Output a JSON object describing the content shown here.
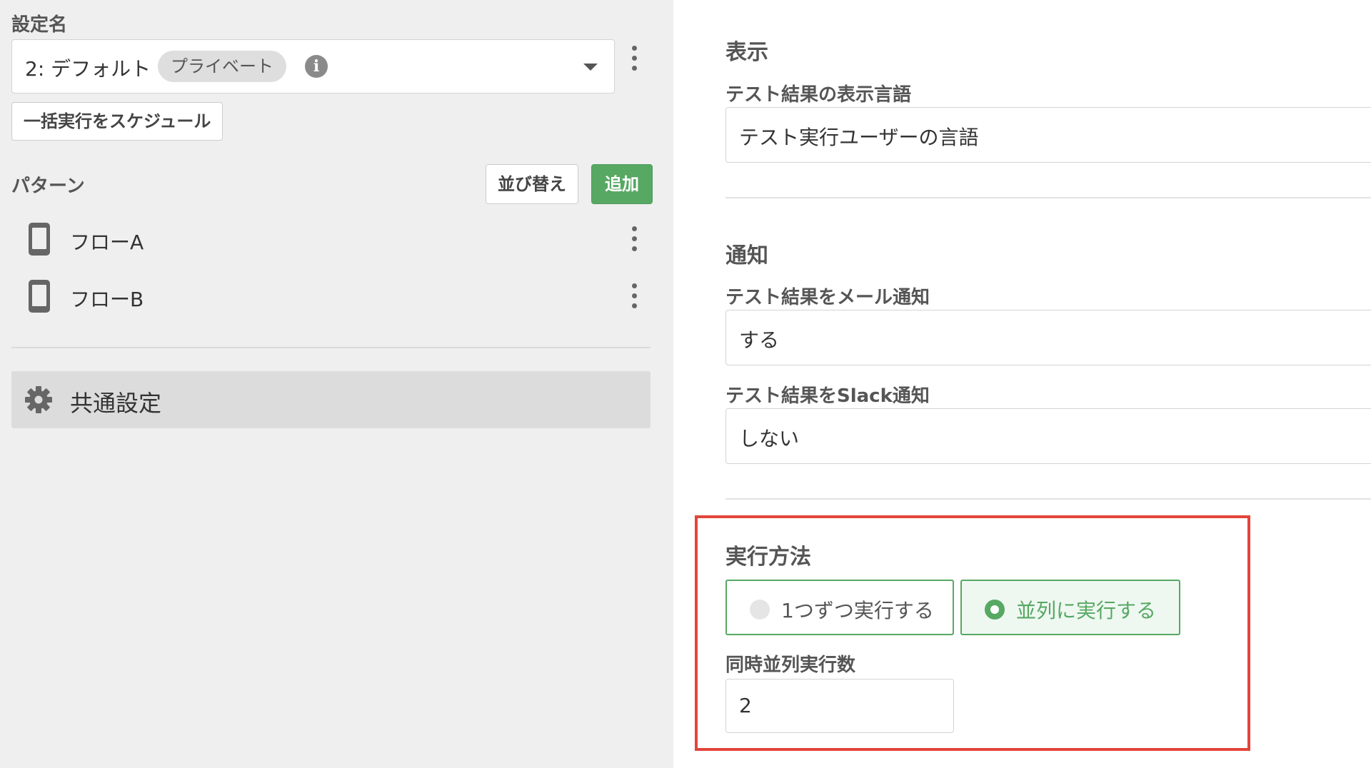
{
  "left_panel": {
    "setting_label": "設定名",
    "setting_select": {
      "value": "2: デフォルト",
      "badge": "プライベート",
      "info_icon": "i"
    },
    "schedule_button": "一括実行をスケジュール",
    "patterns": {
      "label": "パターン",
      "sort_button": "並び替え",
      "add_button": "追加",
      "items": [
        {
          "name": "フローA",
          "icon": "phone-icon"
        },
        {
          "name": "フローB",
          "icon": "phone-icon"
        }
      ]
    },
    "common_settings": {
      "label": "共通設定",
      "icon": "gear-icon"
    }
  },
  "right_panel": {
    "display": {
      "title": "表示",
      "language_label": "テスト結果の表示言語",
      "language_value": "テスト実行ユーザーの言語"
    },
    "notification": {
      "title": "通知",
      "email_label": "テスト結果をメール通知",
      "email_value": "する",
      "slack_label": "テスト結果をSlack通知",
      "slack_value": "しない"
    },
    "execution": {
      "title": "実行方法",
      "options": [
        {
          "label": "1つずつ実行する",
          "selected": false
        },
        {
          "label": "並列に実行する",
          "selected": true
        }
      ],
      "concurrency_label": "同時並列実行数",
      "concurrency_value": "2"
    }
  },
  "colors": {
    "accent_green": "#57a863",
    "highlight_red": "#e2453a",
    "left_background": "#efefef"
  }
}
